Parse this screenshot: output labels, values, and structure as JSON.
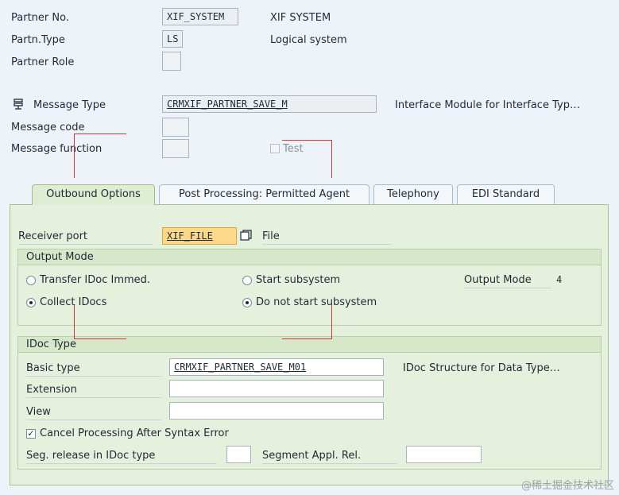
{
  "partner": {
    "no_label": "Partner No.",
    "no_value": "XIF_SYSTEM",
    "no_desc": "XIF SYSTEM",
    "type_label": "Partn.Type",
    "type_value": "LS",
    "type_desc": "Logical system",
    "role_label": "Partner Role"
  },
  "message": {
    "type_label": "Message Type",
    "type_value": "CRMXIF_PARTNER_SAVE_M",
    "type_desc": "Interface Module for Interface Typ…",
    "code_label": "Message code",
    "function_label": "Message function",
    "test_label": "Test"
  },
  "tabs": [
    {
      "label": "Outbound Options"
    },
    {
      "label": "Post Processing: Permitted Agent"
    },
    {
      "label": "Telephony"
    },
    {
      "label": "EDI Standard"
    }
  ],
  "outbound": {
    "receiver_port_label": "Receiver port",
    "receiver_port_value": "XIF_FILE",
    "receiver_port_desc": "File",
    "output_mode": {
      "title": "Output Mode",
      "transfer_label": "Transfer IDoc Immed.",
      "collect_label": "Collect IDocs",
      "start_label": "Start subsystem",
      "nostart_label": "Do not start subsystem",
      "mode_label": "Output Mode",
      "mode_value": "4"
    },
    "idoc_type": {
      "title": "IDoc Type",
      "basic_label": "Basic type",
      "basic_value": "CRMXIF_PARTNER_SAVE_M01",
      "basic_desc": "IDoc Structure for Data Type…",
      "extension_label": "Extension",
      "view_label": "View",
      "cancel_label": "Cancel Processing After Syntax Error",
      "seg_release_label": "Seg. release in IDoc type",
      "segment_appl_label": "Segment Appl. Rel."
    }
  },
  "watermark": "@稀土掘金技术社区"
}
